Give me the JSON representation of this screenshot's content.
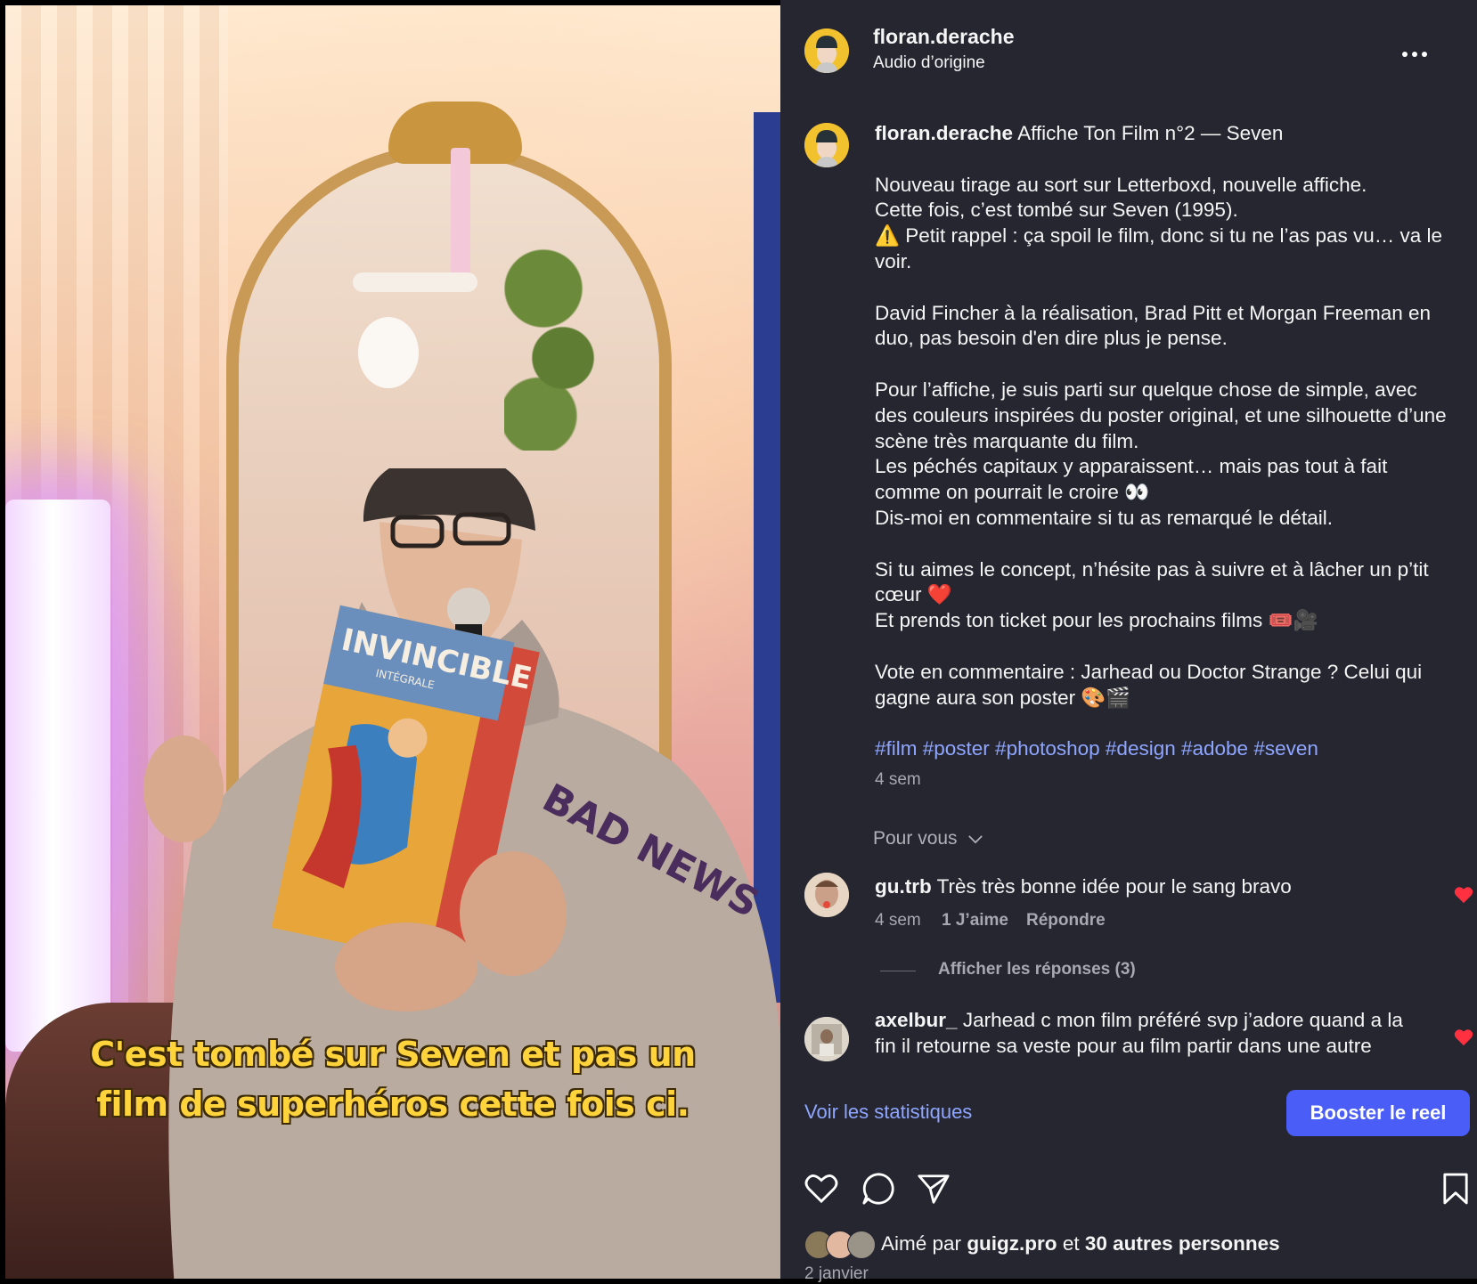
{
  "video": {
    "subtitle_line1": "C'est tombé sur Seven et pas un",
    "subtitle_line2": "film de superhéros cette fois ci.",
    "book_title": "INVINCIBLE",
    "book_subtitle": "INTÉGRALE",
    "hoodie_text": "BAD NEWS"
  },
  "header": {
    "username": "floran.derache",
    "audio": "Audio d’origine"
  },
  "caption": {
    "username": "floran.derache",
    "title": "Affiche Ton Film n°2 — Seven",
    "p1": [
      "Nouveau tirage au sort sur Letterboxd, nouvelle affiche.",
      "Cette fois, c’est tombé sur Seven (1995).",
      "⚠️ Petit rappel : ça spoil le film, donc si tu ne l’as pas vu… va le voir."
    ],
    "p2": "David Fincher à la réalisation, Brad Pitt et Morgan Freeman en duo, pas besoin d'en dire plus je pense.",
    "p3": [
      "Pour l’affiche, je suis parti sur quelque chose de simple, avec des couleurs inspirées du poster original, et une silhouette d’une scène très marquante du film.",
      "Les péchés capitaux y apparaissent… mais pas tout à fait comme on pourrait le croire 👀",
      "Dis-moi en commentaire si tu as remarqué le détail."
    ],
    "p4": [
      "Si tu aimes le concept, n’hésite pas à suivre et à lâcher un p’tit cœur ❤️",
      "Et prends ton ticket pour les prochains films 🎟️🎥"
    ],
    "p5": "Vote en commentaire : Jarhead ou Doctor Strange ? Celui qui gagne aura son poster 🎨🎬",
    "hashtags": "#film #poster #photoshop #design #adobe #seven",
    "time": "4 sem"
  },
  "sort": {
    "label": "Pour vous"
  },
  "comments": [
    {
      "username": "gu.trb",
      "text": "Très très bonne idée pour le sang bravo",
      "time": "4 sem",
      "likes": "1 J’aime",
      "reply": "Répondre",
      "view_replies": "Afficher les réponses (3)"
    },
    {
      "username": "axelbur_",
      "text": "Jarhead c mon film préféré svp j’adore quand a la fin il retourne sa veste pour au film partir dans une autre"
    }
  ],
  "actions": {
    "stats": "Voir les statistiques",
    "boost": "Booster le reel"
  },
  "likes": {
    "prefix": "Aimé par",
    "user": "guigz.pro",
    "and": "et",
    "others": "30 autres personnes"
  },
  "date": "2 janvier",
  "colors": {
    "panel_bg": "#262631",
    "accent": "#4a5df7",
    "hashtag": "#8ea6ff",
    "like_red": "#ff3040",
    "subtitle_yellow": "#ffd33b"
  }
}
